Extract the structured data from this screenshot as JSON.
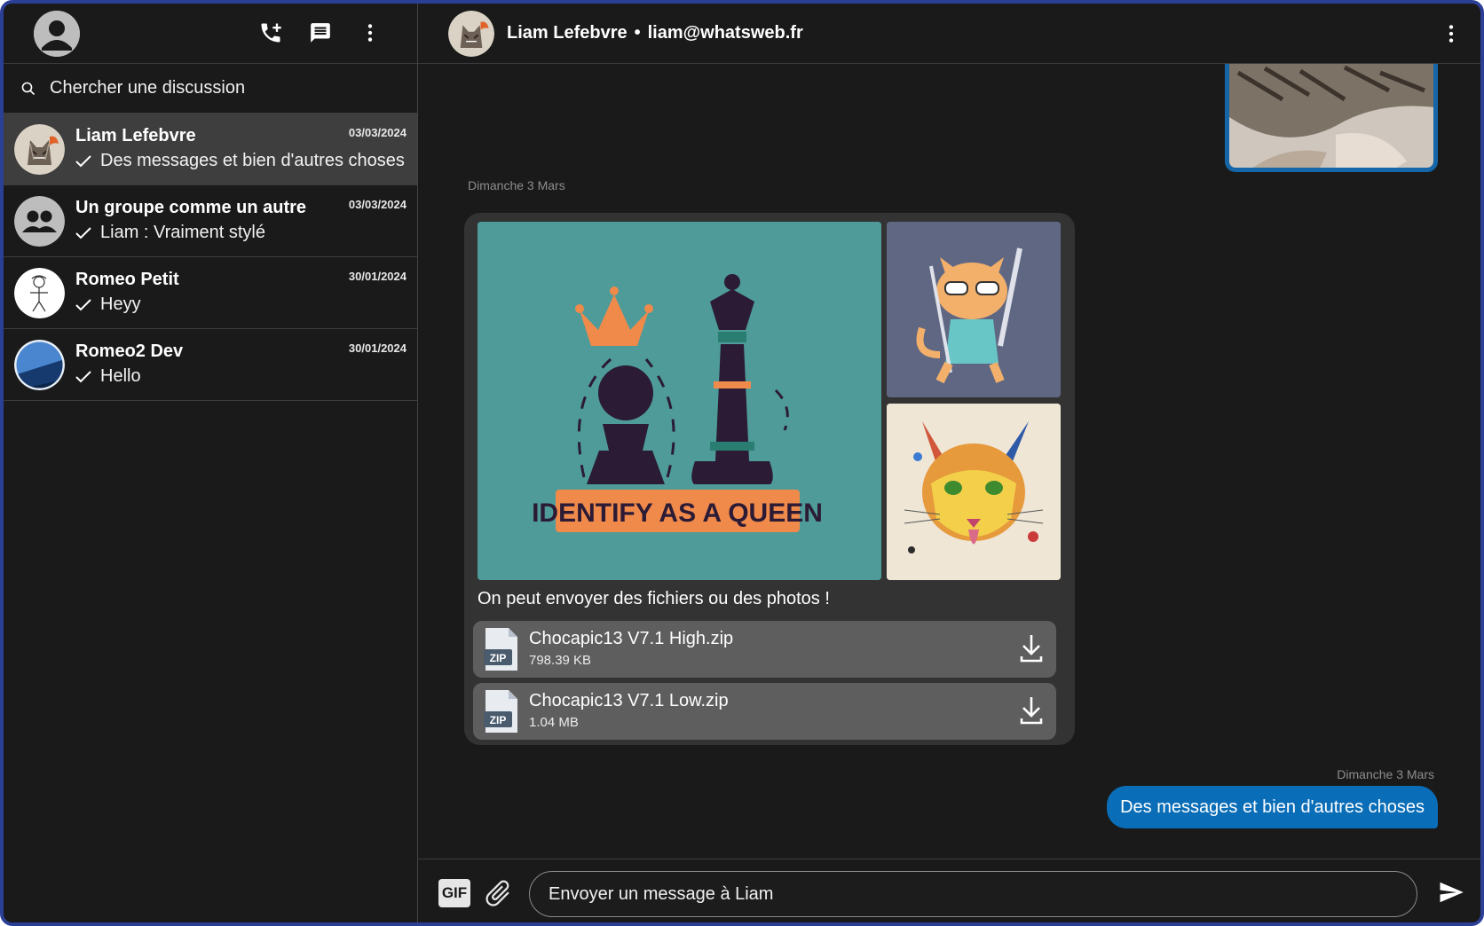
{
  "colors": {
    "app_bg": "#1a1a1a",
    "frame": "#2c3f97",
    "active_row": "#3e3e3e",
    "incoming_bubble": "#333333",
    "file_row": "#5e5e5e",
    "outgoing_bubble": "#0a6db7"
  },
  "sidebar": {
    "header_icons": [
      "account-avatar-icon",
      "phone-add-icon",
      "new-message-icon",
      "more-vert-icon"
    ],
    "search": {
      "placeholder": "Chercher une discussion"
    },
    "conversations": [
      {
        "name": "Liam Lefebvre",
        "date": "03/03/2024",
        "preview": "Des messages et bien d'autres choses",
        "active": true
      },
      {
        "name": "Un groupe comme un autre",
        "date": "03/03/2024",
        "preview": "Liam : Vraiment stylé",
        "active": false
      },
      {
        "name": "Romeo Petit",
        "date": "30/01/2024",
        "preview": "Heyy",
        "active": false
      },
      {
        "name": "Romeo2 Dev",
        "date": "30/01/2024",
        "preview": "Hello",
        "active": false
      }
    ]
  },
  "chat": {
    "contact_name": "Liam Lefebvre",
    "separator": "•",
    "contact_email": "liam@whatsweb.fr",
    "day_label_1": "Dimanche 3 Mars",
    "incoming": {
      "image_caption_text": "IDENTIFY AS A QUEEN",
      "text": "On peut envoyer des fichiers ou des photos !",
      "files": [
        {
          "name": "Chocapic13 V7.1 High.zip",
          "size": "798.39 KB",
          "type_label": "ZIP"
        },
        {
          "name": "Chocapic13 V7.1 Low.zip",
          "size": "1.04 MB",
          "type_label": "ZIP"
        }
      ]
    },
    "day_label_2": "Dimanche 3 Mars",
    "outgoing": {
      "text": "Des messages et bien d'autres choses"
    }
  },
  "composer": {
    "gif_label": "GIF",
    "placeholder": "Envoyer un message à Liam"
  }
}
